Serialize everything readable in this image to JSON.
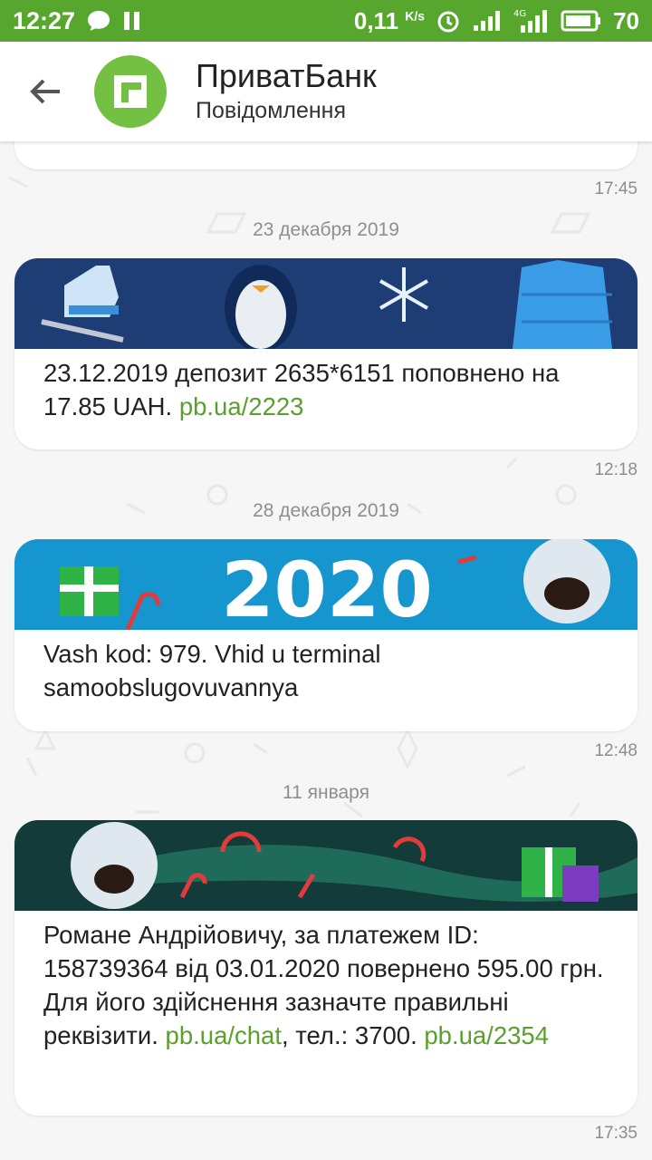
{
  "status_bar": {
    "time": "12:27",
    "speed": "0,11",
    "speed_unit": "K/s",
    "network": "4G",
    "battery": "70"
  },
  "header": {
    "title": "ПриватБанк",
    "subtitle": "Повідомлення"
  },
  "messages": [
    {
      "time": "17:45"
    },
    {
      "date": "23 декабря 2019",
      "text": "23.12.2019 депозит 2635*6151 поповнено на 17.85 UAH. ",
      "link": "pb.ua/2223",
      "time": "12:18",
      "banner_icons": [
        "skate-icon",
        "penguin-icon",
        "snowflake-icon",
        "jacket-icon"
      ]
    },
    {
      "date": "28 декабря 2019",
      "line1": "Vash kod: 979. Vhid u terminal",
      "line2": "samoobslugovuvannya",
      "time": "12:48",
      "banner_text": "2020"
    },
    {
      "date": "11 января",
      "text_part1": "Романе Андрійовичу, за платежем ID: 158739364 від 03.01.2020 повернено 595.00 грн. Для його здійснення зазначте правильні реквізити. ",
      "link1": "pb.ua/chat",
      "text_part2": ", тел.: 3700. ",
      "link2": "pb.ua/2354",
      "time": "17:35"
    }
  ],
  "colors": {
    "status_bar": "#57a72f",
    "logo": "#74c043",
    "link": "#5aa02c"
  }
}
